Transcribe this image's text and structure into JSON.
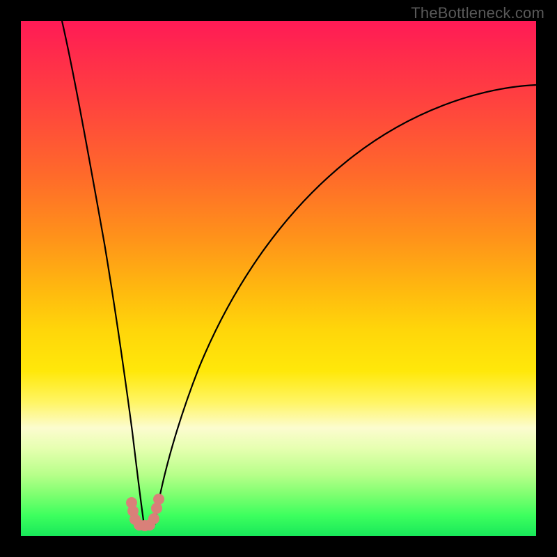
{
  "watermark": "TheBottleneck.com",
  "colors": {
    "frame": "#000000",
    "curve": "#000000",
    "dot": "#d98079",
    "gradient_top": "#ff1a56",
    "gradient_bottom": "#18e85a"
  },
  "chart_data": {
    "type": "line",
    "title": "",
    "xlabel": "",
    "ylabel": "",
    "xlim": [
      0,
      100
    ],
    "ylim": [
      0,
      100
    ],
    "grid": false,
    "series": [
      {
        "name": "left-branch",
        "x": [
          8,
          10,
          12,
          14,
          16,
          18,
          20,
          21,
          22,
          23,
          23.5
        ],
        "values": [
          100,
          88,
          76,
          63,
          50,
          37,
          24,
          17,
          11,
          6,
          2
        ]
      },
      {
        "name": "right-branch",
        "x": [
          26,
          28,
          30,
          34,
          38,
          44,
          52,
          62,
          74,
          88,
          100
        ],
        "values": [
          2,
          8,
          15,
          28,
          39,
          51,
          62,
          72,
          79,
          84,
          87
        ]
      }
    ],
    "markers": [
      {
        "x": 21.5,
        "y": 6.5
      },
      {
        "x": 21.8,
        "y": 4.8
      },
      {
        "x": 22.2,
        "y": 3.2
      },
      {
        "x": 23.0,
        "y": 2.2
      },
      {
        "x": 24.0,
        "y": 2.0
      },
      {
        "x": 25.0,
        "y": 2.2
      },
      {
        "x": 25.8,
        "y": 3.4
      },
      {
        "x": 26.4,
        "y": 5.4
      },
      {
        "x": 26.8,
        "y": 7.2
      }
    ],
    "note": "Axis values are percent of plot area (0=left/bottom, 100=right/top); no numeric ticks are visible in the image."
  }
}
